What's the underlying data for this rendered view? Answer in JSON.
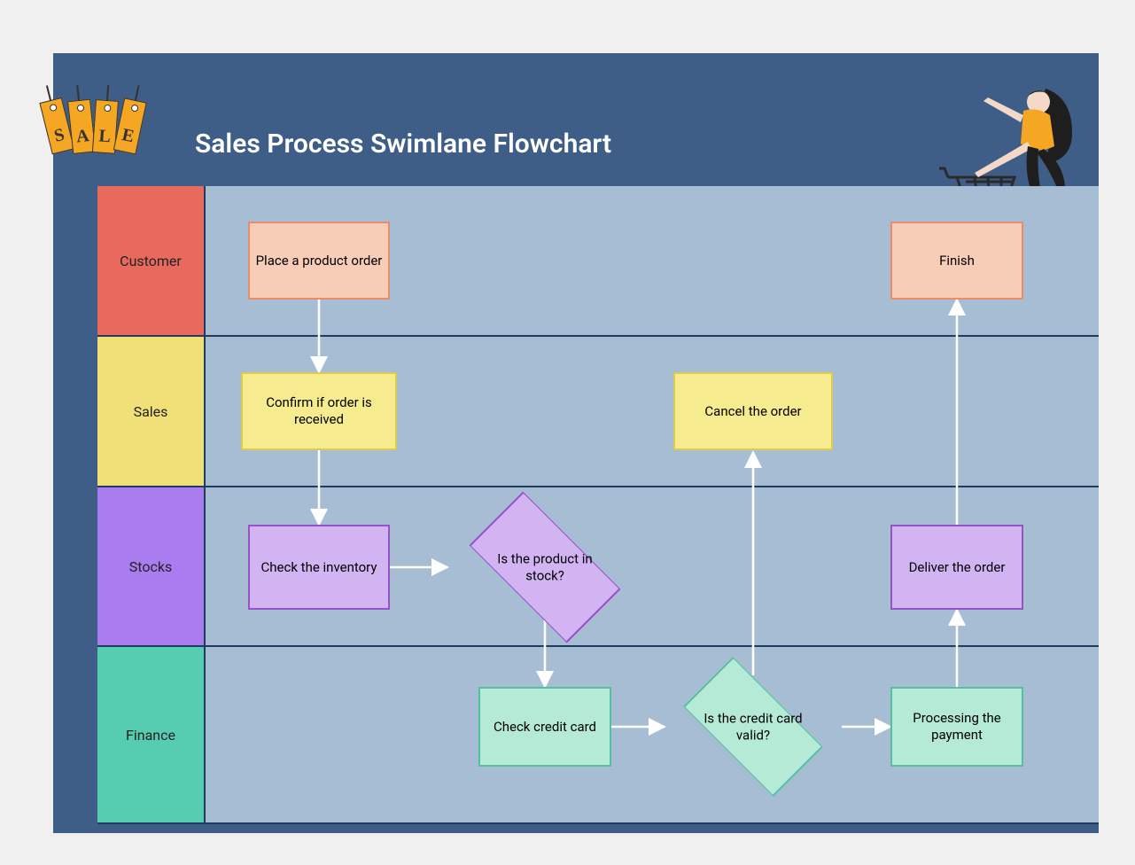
{
  "title": "Sales Process Swimlane Flowchart",
  "sale_tag_letters": [
    "S",
    "A",
    "L",
    "E"
  ],
  "lanes": {
    "customer": "Customer",
    "sales": "Sales",
    "stocks": "Stocks",
    "finance": "Finance"
  },
  "nodes": {
    "place_order": "Place a product order",
    "finish": "Finish",
    "confirm_order": "Confirm if order is received",
    "cancel_order": "Cancel the order",
    "check_inventory": "Check the inventory",
    "in_stock_q": "Is the product in stock?",
    "deliver_order": "Deliver the order",
    "check_credit": "Check credit card",
    "card_valid_q": "Is the credit card valid?",
    "process_payment": "Processing the payment"
  },
  "colors": {
    "panel_bg": "#3e5d87",
    "lane_body": "#a7bdd3",
    "lane_border": "#1f3b5e",
    "customer_header": "#e86a5e",
    "sales_header": "#f1e078",
    "stocks_header": "#a97df0",
    "finance_header": "#56ccb0",
    "peach_fill": "#f7cdb8",
    "peach_border": "#e98e6a",
    "yellow_fill": "#f6ec8f",
    "yellow_border": "#d9cc4e",
    "purple_fill": "#d2b4f2",
    "purple_border": "#9653c9",
    "mint_fill": "#b4ead6",
    "mint_border": "#56bfa0",
    "arrow": "#ffffff"
  },
  "flow_edges": [
    [
      "place_order",
      "confirm_order"
    ],
    [
      "confirm_order",
      "check_inventory"
    ],
    [
      "check_inventory",
      "in_stock_q"
    ],
    [
      "in_stock_q",
      "check_credit"
    ],
    [
      "check_credit",
      "card_valid_q"
    ],
    [
      "card_valid_q",
      "cancel_order"
    ],
    [
      "card_valid_q",
      "process_payment"
    ],
    [
      "process_payment",
      "deliver_order"
    ],
    [
      "deliver_order",
      "finish"
    ]
  ]
}
